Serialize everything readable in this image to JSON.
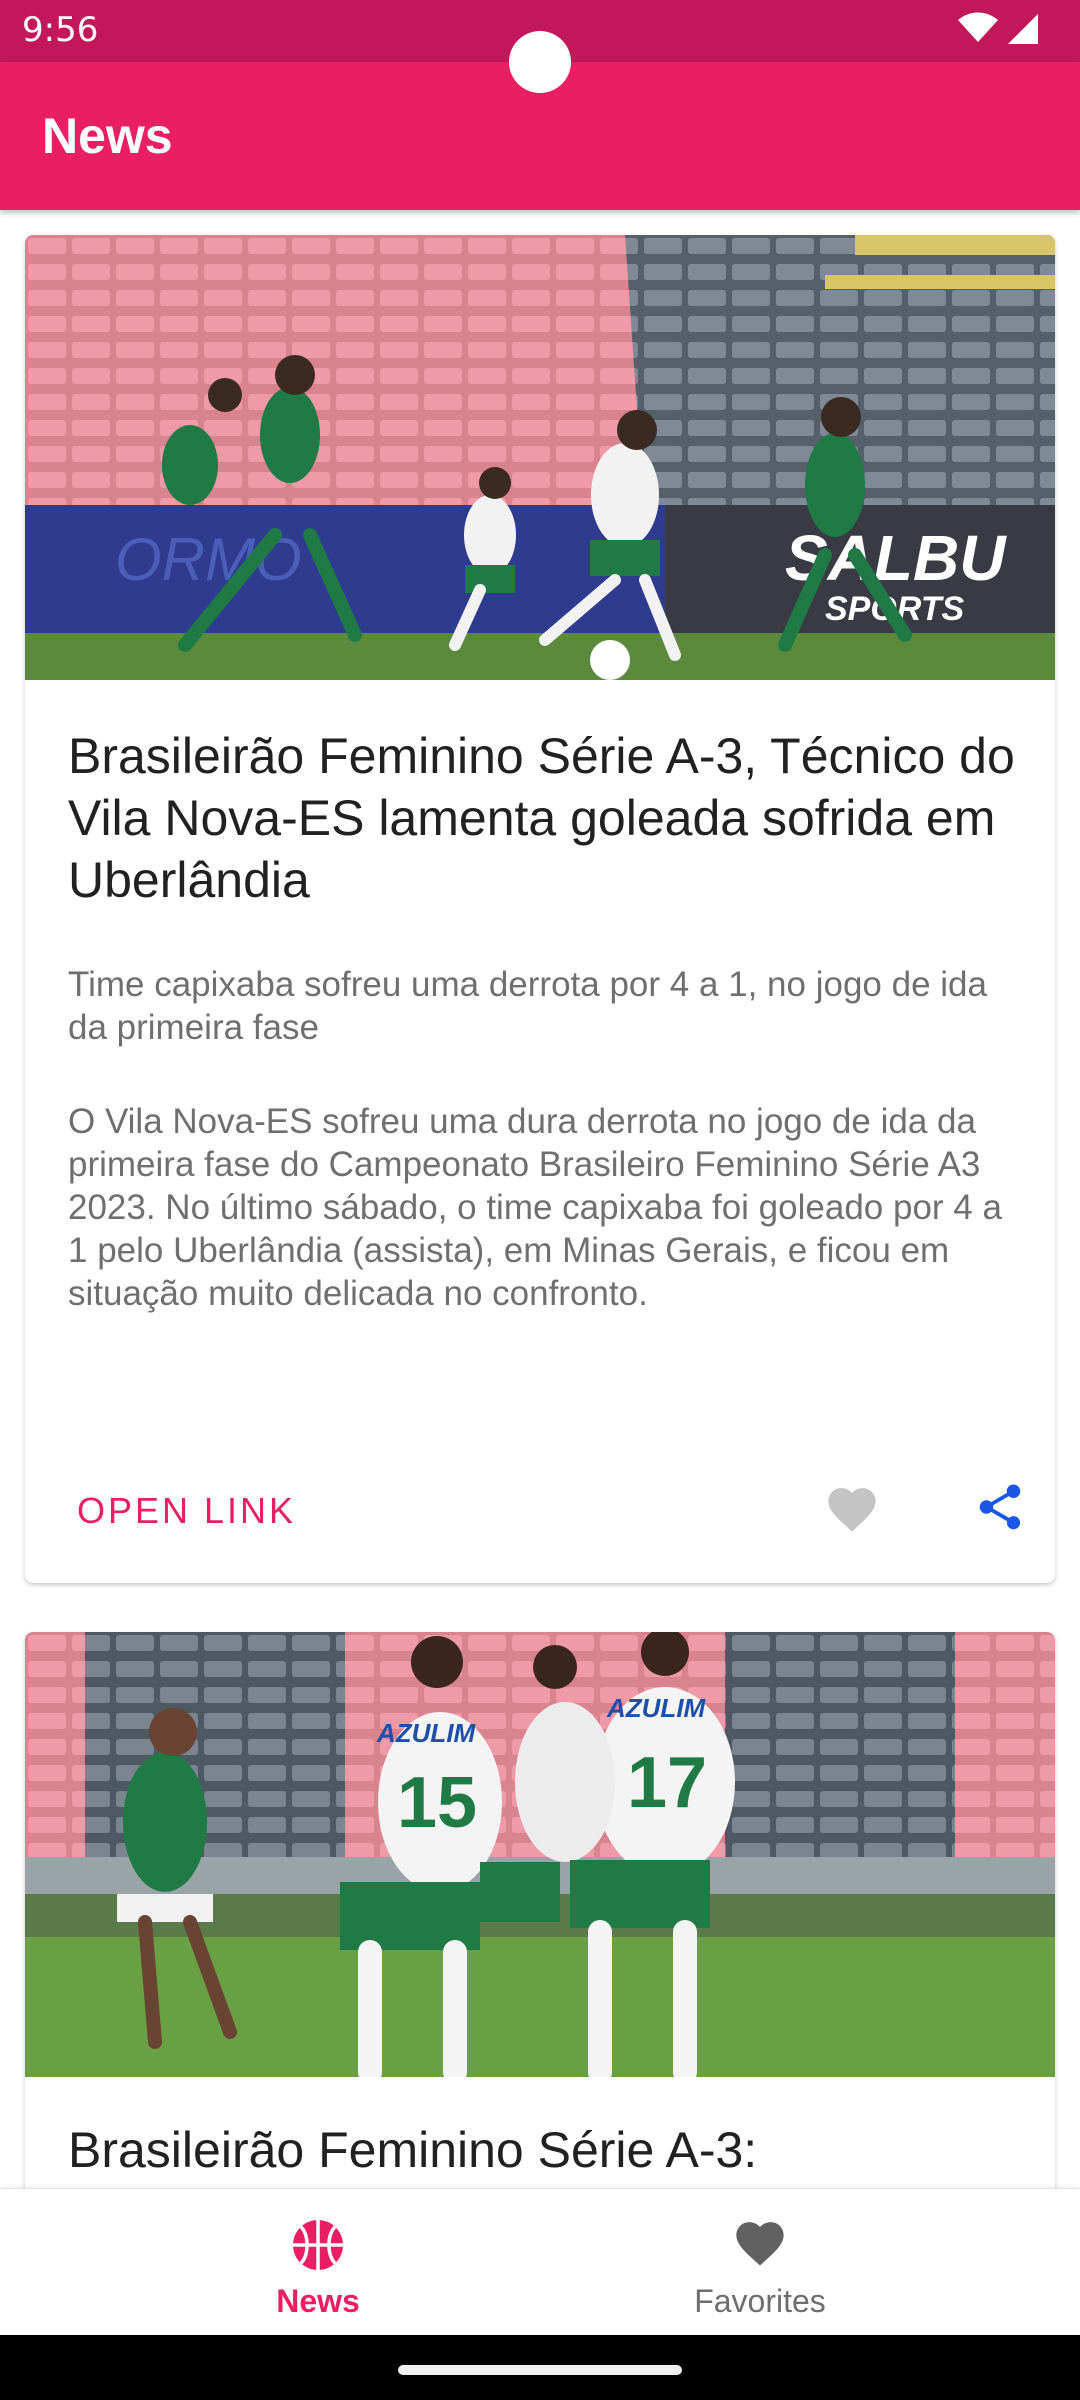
{
  "status_bar": {
    "time": "9:56",
    "wifi_icon": "wifi-icon",
    "signal_icon": "signal-icon",
    "background": "#c2185b"
  },
  "app_bar": {
    "title": "News",
    "background": "#e91e63"
  },
  "articles": [
    {
      "image": "Women's soccer players in green and white kits running for the ball in a stadium",
      "title": "Brasileirão Feminino Série A-3, Técnico do Vila Nova-ES lamenta goleada sofrida em Uberlândia",
      "subtitle": "Time capixaba sofreu uma derrota por 4 a 1, no jogo de ida da primeira fase",
      "body": "O Vila Nova-ES sofreu uma dura derrota no jogo de ida da primeira fase do Campeonato Brasileiro Feminino Série A3 2023. No último sábado, o time capixaba foi goleado por 4 a 1 pelo Uberlândia (assista), em Minas Gerais, e ficou em situação muito delicada no confronto.",
      "open_link_label": "OPEN LINK",
      "favorite_icon": "heart-icon",
      "favorite_color": "#c4c4c4",
      "share_icon": "share-icon",
      "share_color": "#1a56e8"
    },
    {
      "image": "Players in white jerseys numbered 15 and 17 celebrating together on the pitch",
      "title": "Brasileirão Feminino Série A-3:"
    }
  ],
  "bottom_nav": {
    "items": [
      {
        "label": "News",
        "icon": "basketball-icon",
        "active": true,
        "color": "#e91e63"
      },
      {
        "label": "Favorites",
        "icon": "heart-icon",
        "active": false,
        "color": "#616161"
      }
    ]
  }
}
